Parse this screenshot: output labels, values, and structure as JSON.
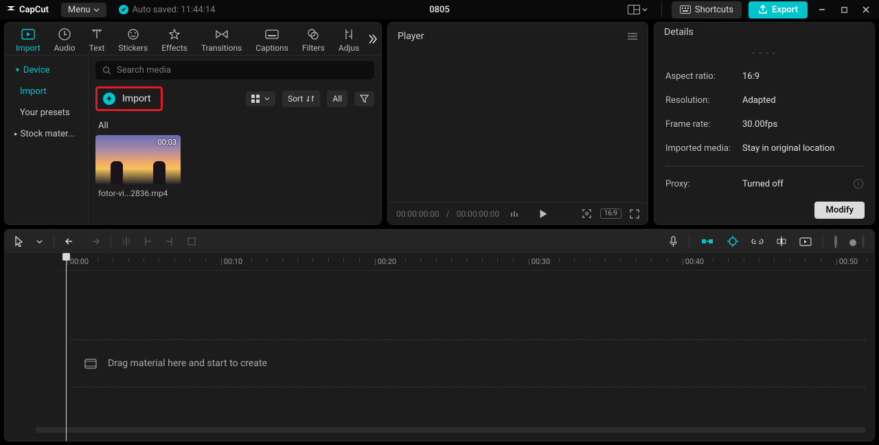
{
  "titlebar": {
    "brand": "CapCut",
    "menu": "Menu",
    "autosave": "Auto saved: 11:44:14",
    "project_title": "0805",
    "shortcuts": "Shortcuts",
    "export": "Export"
  },
  "asset_tabs": {
    "items": [
      {
        "label": "Import"
      },
      {
        "label": "Audio"
      },
      {
        "label": "Text"
      },
      {
        "label": "Stickers"
      },
      {
        "label": "Effects"
      },
      {
        "label": "Transitions"
      },
      {
        "label": "Captions"
      },
      {
        "label": "Filters"
      },
      {
        "label": "Adjus"
      }
    ]
  },
  "left_nav": {
    "device": "Device",
    "import": "Import",
    "presets": "Your presets",
    "stock": "Stock mater..."
  },
  "media": {
    "search_placeholder": "Search media",
    "import_label": "Import",
    "sort": "Sort",
    "all_pill": "All",
    "section_all": "All",
    "thumb0": {
      "duration": "00:03",
      "filename": "fotor-vi...2836.mp4"
    }
  },
  "player": {
    "title": "Player",
    "time_current": "00:00:00:00",
    "time_total": "00:00:00:00",
    "ratio_badge": "16:9"
  },
  "details": {
    "title": "Details",
    "dots": "- - - -",
    "rows": {
      "aspect_k": "Aspect ratio:",
      "aspect_v": "16:9",
      "res_k": "Resolution:",
      "res_v": "Adapted",
      "fps_k": "Frame rate:",
      "fps_v": "30.00fps",
      "imp_k": "Imported media:",
      "imp_v": "Stay in original location",
      "proxy_k": "Proxy:",
      "proxy_v": "Turned off"
    },
    "modify": "Modify"
  },
  "timeline": {
    "drop_hint": "Drag material here and start to create",
    "marks": [
      "00:00",
      "00:10",
      "00:20",
      "00:30",
      "00:40",
      "00:50"
    ]
  }
}
